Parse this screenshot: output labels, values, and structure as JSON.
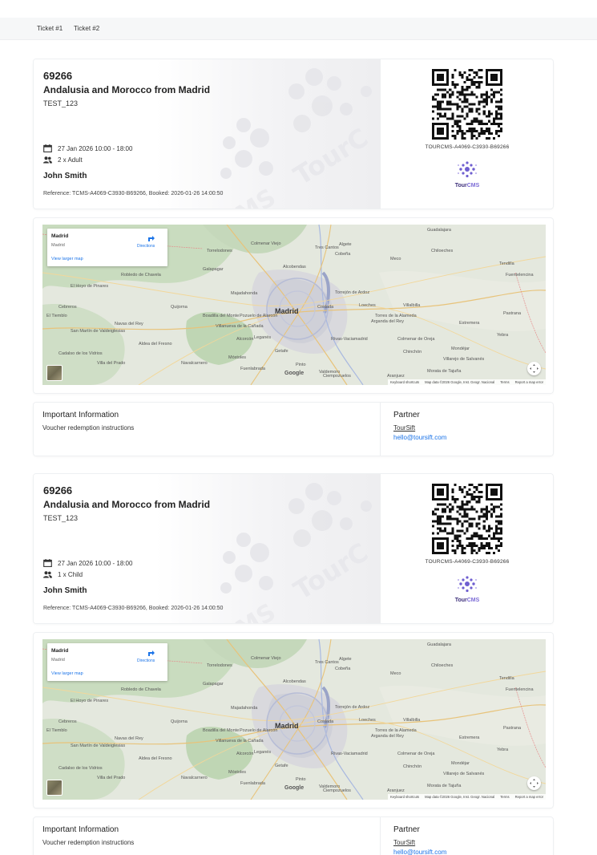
{
  "tabs": [
    "Ticket #1",
    "Ticket #2"
  ],
  "tickets": [
    {
      "id": "69266",
      "name": "Andalusia and Morocco from Madrid",
      "code": "TEST_123",
      "date": "27 Jan 2026 10:00 - 18:00",
      "pax": "2 x Adult",
      "customer": "John Smith",
      "reference": "Reference: TCMS-A4069-C3930-B69266, Booked: 2026-01-26 14:00:50",
      "qr_text": "TOURCMS-A4069-C3930-B69266",
      "logo": {
        "tour": "Tour",
        "cms": "CMS"
      },
      "map": {
        "place": "Madrid",
        "place_sub": "Madrid",
        "directions": "Directions",
        "larger": "View larger map",
        "google": "Google",
        "footer": [
          "Keyboard shortcuts",
          "Map data ©2026 Google, Inst. Geogr. Nacional",
          "Terms",
          "Report a map error"
        ]
      },
      "info": {
        "title": "Important Information",
        "text": "Voucher redemption instructions"
      },
      "partner": {
        "title": "Partner",
        "name": "TourSift",
        "email": "hello@toursift.com"
      }
    },
    {
      "id": "69266",
      "name": "Andalusia and Morocco from Madrid",
      "code": "TEST_123",
      "date": "27 Jan 2026 10:00 - 18:00",
      "pax": "1 x Child",
      "customer": "John Smith",
      "reference": "Reference: TCMS-A4069-C3930-B69266, Booked: 2026-01-26 14:00:50",
      "qr_text": "TOURCMS-A4069-C3930-B69266",
      "logo": {
        "tour": "Tour",
        "cms": "CMS"
      },
      "map": {
        "place": "Madrid",
        "place_sub": "Madrid",
        "directions": "Directions",
        "larger": "View larger map",
        "google": "Google",
        "footer": [
          "Keyboard shortcuts",
          "Map data ©2026 Google, Inst. Geogr. Nacional",
          "Terms",
          "Report a map error"
        ]
      },
      "info": {
        "title": "Important Information",
        "text": "Voucher redemption instructions"
      },
      "partner": {
        "title": "Partner",
        "name": "TourSift",
        "email": "hello@toursift.com"
      }
    }
  ],
  "map_places": [
    "Madrid",
    "Alcobendas",
    "Torrejón de Ardoz",
    "Coslada",
    "Getafe",
    "Leganés",
    "Alcorcón",
    "Móstoles",
    "Fuenlabrada",
    "Pozuelo de Alarcón",
    "Majadahonda",
    "Boadilla del Monte",
    "Rivas-Vaciamadrid",
    "Villalbilla",
    "Tres Cantos",
    "Colmenar Viejo",
    "Algete",
    "Cobeña",
    "Meco",
    "Chiloeches",
    "Guadalajara",
    "Torrelodones",
    "Galapagar",
    "Villanueva de la Cañada",
    "Navalcarnero",
    "Pinto",
    "Valdemoro",
    "Arganda del Rey",
    "Mondéjar",
    "Pastrana",
    "Yebra",
    "Quijorna",
    "Navas del Rey",
    "San Martín de Valdeiglesias",
    "El Tiemblo",
    "Cadalso de los Vidrios",
    "Villa del Prado",
    "Aldea del Fresno",
    "El Hoyo de Pinares",
    "Robledo de Chavela",
    "Cebreros",
    "Loeches",
    "Fuentelencina",
    "Tendilla",
    "Torres de la Alameda",
    "Chinchón",
    "Ciempozuelos",
    "Aranjuez",
    "Colmenar de Oreja",
    "Estremera",
    "Morata de Tajuña",
    "Villarejo de Salvanés"
  ]
}
